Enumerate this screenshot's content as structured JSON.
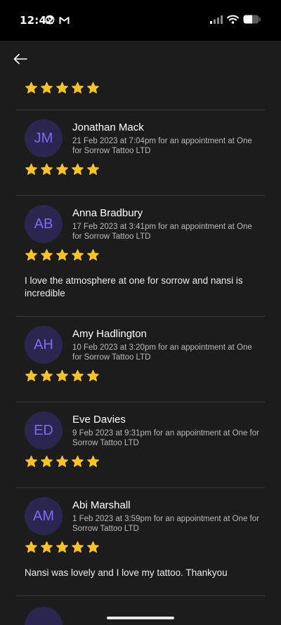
{
  "status_bar": {
    "time": "12:42"
  },
  "top_rating": 5,
  "reviews": [
    {
      "initials": "JM",
      "name": "Jonathan Mack",
      "meta": "21 Feb 2023 at 7:04pm for an appointment at One for Sorrow Tattoo LTD",
      "rating": 5,
      "comment": ""
    },
    {
      "initials": "AB",
      "name": "Anna Bradbury",
      "meta": "17 Feb 2023 at 3:41pm for an appointment at One for Sorrow Tattoo LTD",
      "rating": 5,
      "comment": "I love the atmosphere at one for sorrow and nansi is incredible"
    },
    {
      "initials": "AH",
      "name": "Amy Hadlington",
      "meta": "10 Feb 2023 at 3:20pm for an appointment at One for Sorrow Tattoo LTD",
      "rating": 5,
      "comment": ""
    },
    {
      "initials": "ED",
      "name": "Eve Davies",
      "meta": "9 Feb 2023 at 9:31pm for an appointment at One for Sorrow Tattoo LTD",
      "rating": 5,
      "comment": ""
    },
    {
      "initials": "AM",
      "name": "Abi Marshall",
      "meta": "1 Feb 2023 at 3:59pm for an appointment at One for Sorrow Tattoo LTD",
      "rating": 5,
      "comment": "Nansi was lovely and I love my tattoo. Thankyou"
    }
  ],
  "colors": {
    "background": "#1c1c1c",
    "star": "#f7c325",
    "avatar_bg": "#2a2650",
    "avatar_text": "#7d6cf0",
    "divider": "#3a3a3a"
  }
}
